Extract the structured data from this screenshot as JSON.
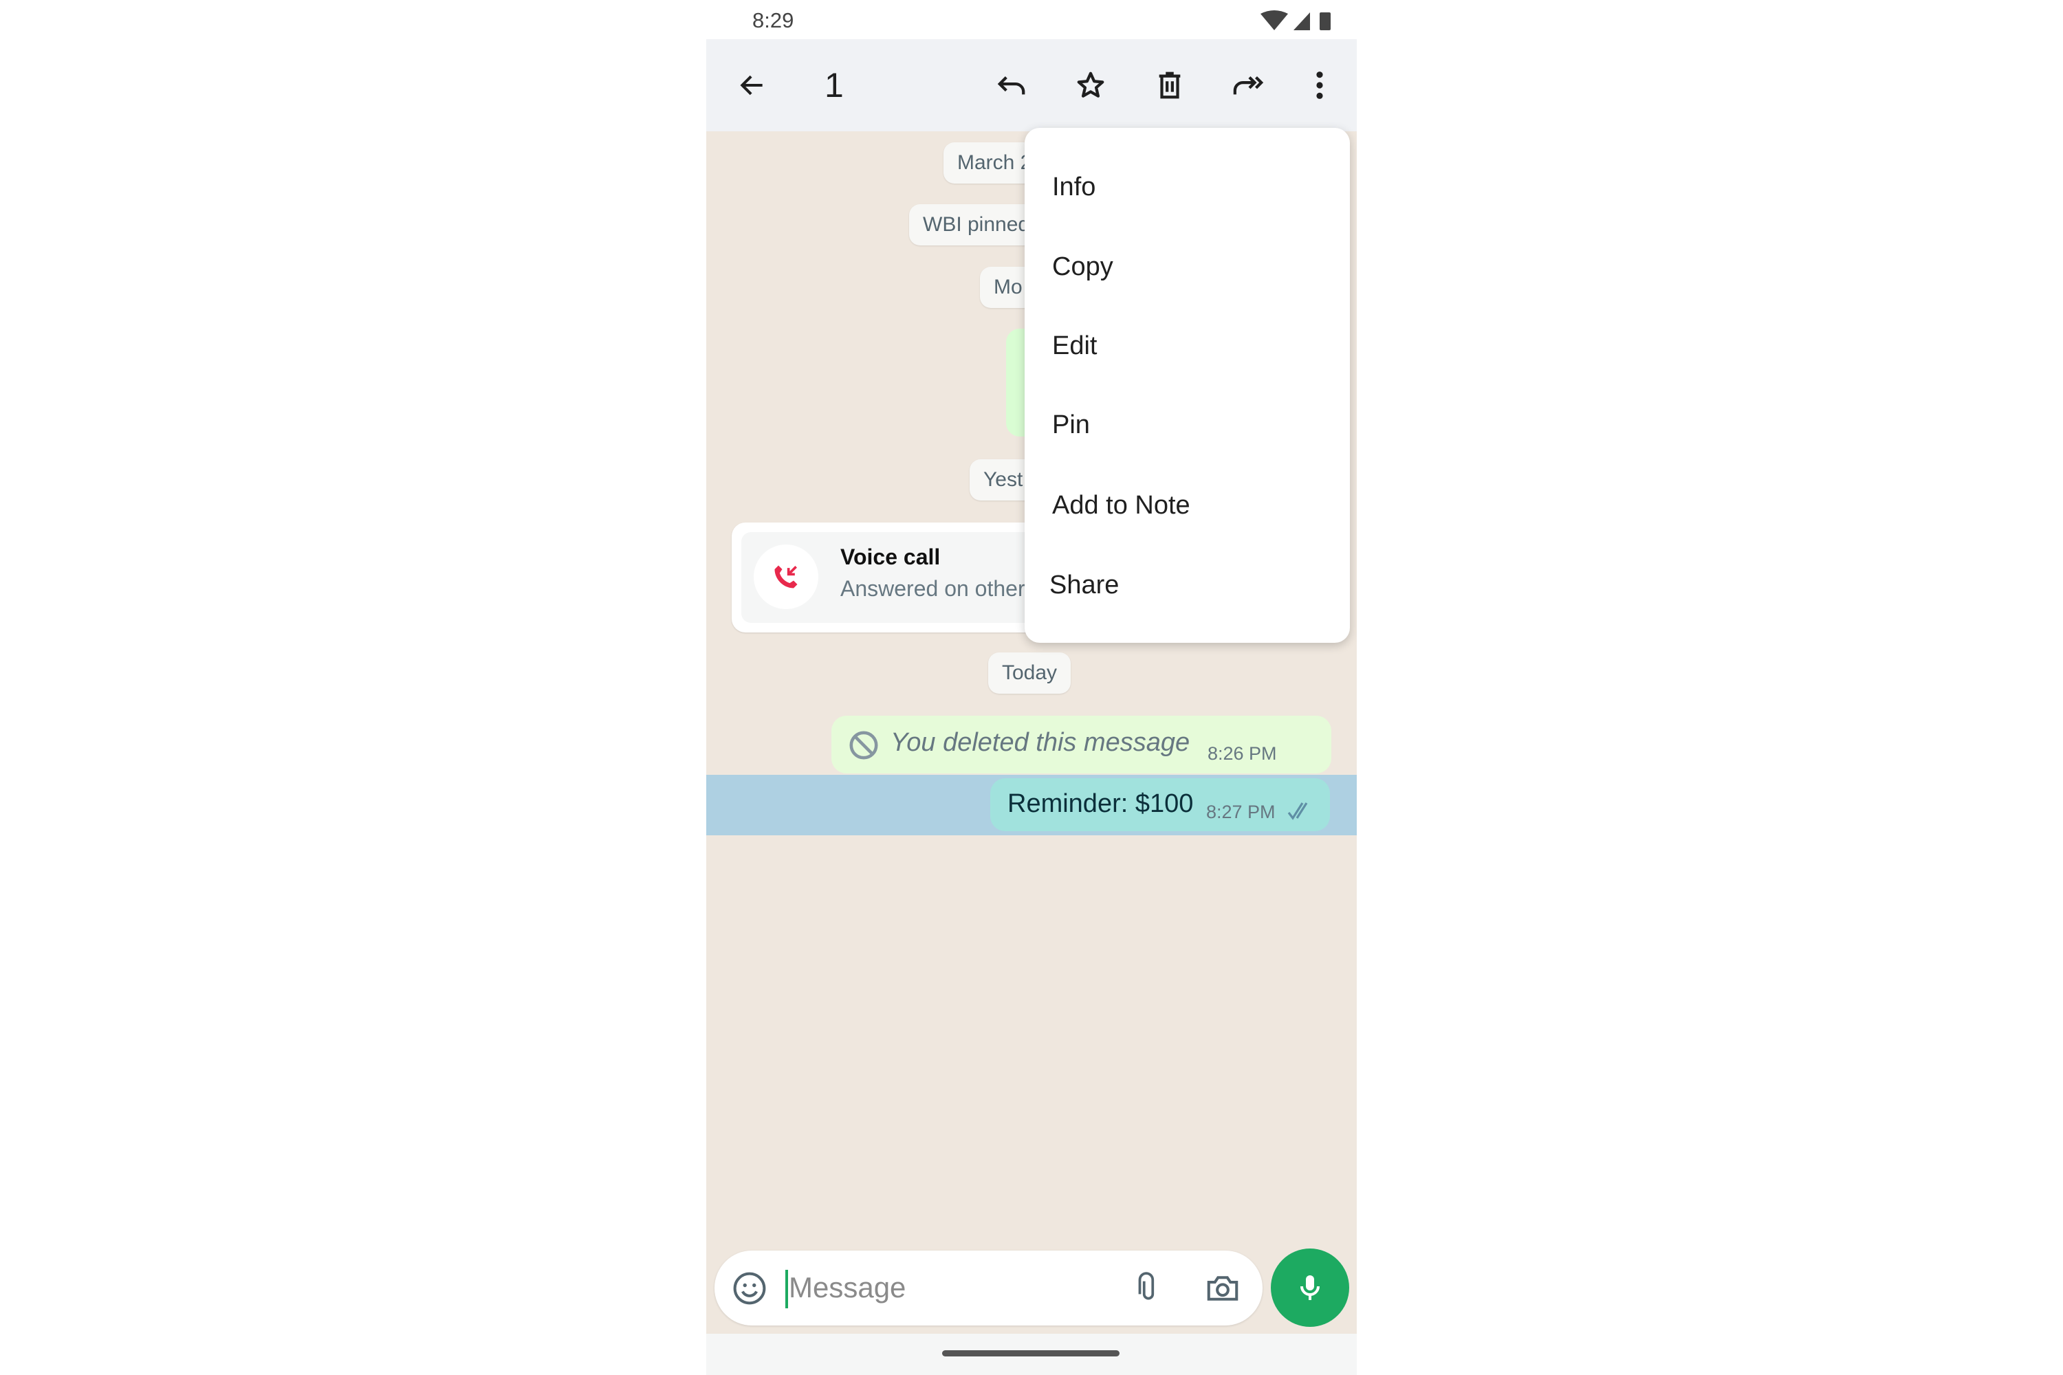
{
  "status_bar": {
    "time": "8:29",
    "icons": [
      "wifi-icon",
      "signal-icon",
      "battery-icon"
    ]
  },
  "toolbar": {
    "selected_count": "1",
    "icons": [
      "back-arrow-icon",
      "reply-icon",
      "star-icon",
      "delete-icon",
      "forward-icon",
      "more-vert-icon"
    ]
  },
  "chat": {
    "date_chips": [
      "March 2",
      "WBI pinned",
      "Mo",
      "Yest",
      "Today"
    ],
    "voice_call": {
      "title": "Voice call",
      "subtitle": "Answered on other"
    },
    "messages": [
      {
        "text": "You deleted this message",
        "time": "8:26 PM",
        "deleted": true
      },
      {
        "text": "Reminder: $100",
        "time": "8:27 PM",
        "status": "read",
        "selected": true
      }
    ]
  },
  "context_menu": {
    "items": [
      "Info",
      "Copy",
      "Edit",
      "Pin",
      "Add to Note",
      "Share"
    ]
  },
  "composer": {
    "placeholder": "Message",
    "icons": [
      "emoji-icon",
      "attach-icon",
      "camera-icon",
      "mic-icon"
    ]
  },
  "colors": {
    "accent": "#1daa61",
    "toolbar_bg": "#f0f2f5",
    "chat_bg": "#efe7de",
    "selected_bubble": "#a1e2dd",
    "outgoing_bubble": "#d9fdd3",
    "missed_call": "#e8294c"
  }
}
